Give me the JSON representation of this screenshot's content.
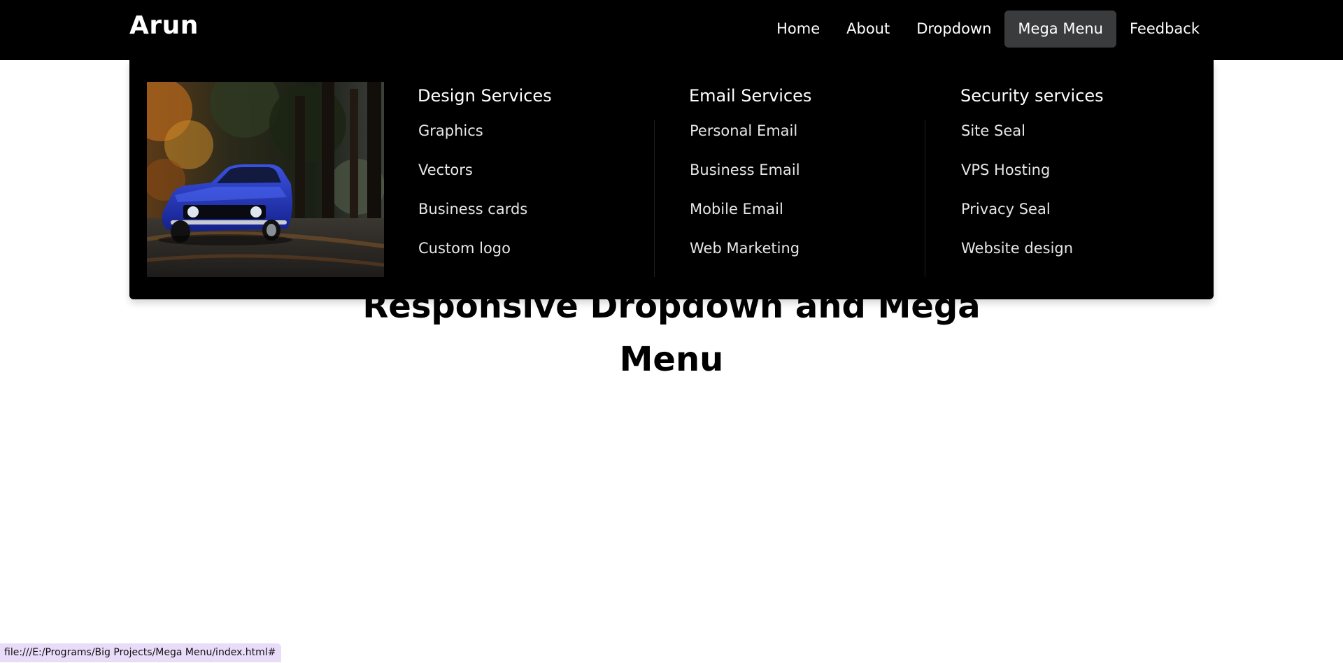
{
  "brand": {
    "logo": "Arun"
  },
  "nav": {
    "items": [
      {
        "label": "Home"
      },
      {
        "label": "About"
      },
      {
        "label": "Dropdown"
      },
      {
        "label": "Mega Menu"
      },
      {
        "label": "Feedback"
      }
    ],
    "active": "Mega Menu"
  },
  "mega_menu": {
    "columns": [
      {
        "heading": "Design Services",
        "links": [
          "Graphics",
          "Vectors",
          "Business cards",
          "Custom logo"
        ]
      },
      {
        "heading": "Email Services",
        "links": [
          "Personal Email",
          "Business Email",
          "Mobile Email",
          "Web Marketing"
        ]
      },
      {
        "heading": "Security services",
        "links": [
          "Site Seal",
          "VPS Hosting",
          "Privacy Seal",
          "Website design"
        ]
      }
    ]
  },
  "hero": {
    "title_line1": "Responsive Dropdown and Mega",
    "title_line2": "Menu"
  },
  "status_bar": {
    "url": "file:///E:/Programs/Big Projects/Mega Menu/index.html#"
  },
  "colors": {
    "navbar_bg": "#000000",
    "active_tab_bg": "#3a3b3c",
    "page_bg": "#ffffff"
  }
}
